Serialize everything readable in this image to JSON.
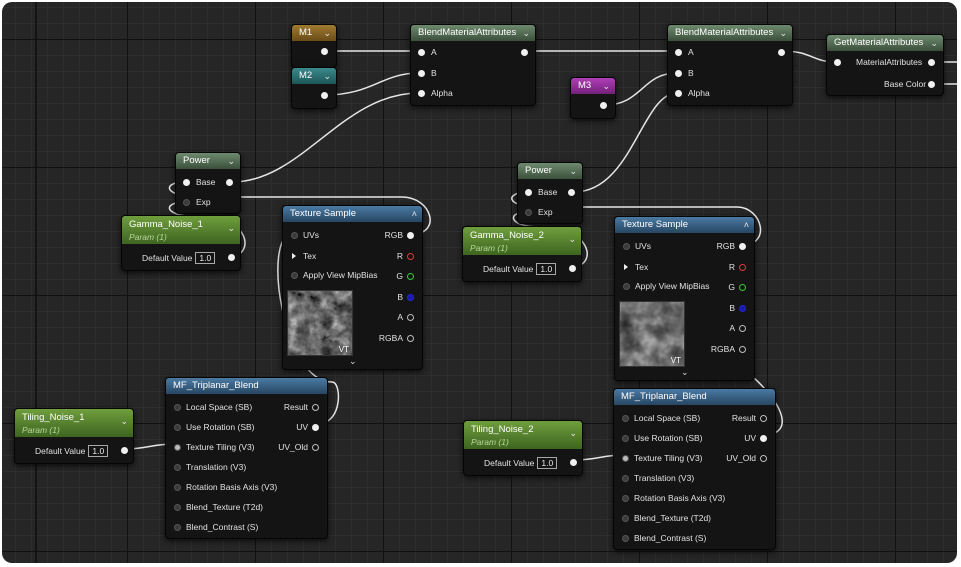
{
  "nodes": {
    "m1": {
      "label": "M1"
    },
    "m2": {
      "label": "M2"
    },
    "m3": {
      "label": "M3"
    },
    "blend1": {
      "title": "BlendMaterialAttributes",
      "pins": [
        "A",
        "B",
        "Alpha"
      ]
    },
    "blend2": {
      "title": "BlendMaterialAttributes",
      "pins": [
        "A",
        "B",
        "Alpha"
      ]
    },
    "getmat": {
      "title": "GetMaterialAttributes",
      "pins": [
        "MaterialAttributes",
        "Base Color"
      ]
    },
    "power1": {
      "title": "Power",
      "pins": [
        "Base",
        "Exp"
      ]
    },
    "power2": {
      "title": "Power",
      "pins": [
        "Base",
        "Exp"
      ]
    },
    "gamma1": {
      "title": "Gamma_Noise_1",
      "sub": "Param (1)",
      "value_label": "Default Value",
      "value": "1.0"
    },
    "gamma2": {
      "title": "Gamma_Noise_2",
      "sub": "Param (1)",
      "value_label": "Default Value",
      "value": "1.0"
    },
    "tiling1": {
      "title": "Tiling_Noise_1",
      "sub": "Param (1)",
      "value_label": "Default Value",
      "value": "1.0"
    },
    "tiling2": {
      "title": "Tiling_Noise_2",
      "sub": "Param (1)",
      "value_label": "Default Value",
      "value": "1.0"
    },
    "tex1": {
      "title": "Texture Sample",
      "inputs": [
        "UVs",
        "Tex",
        "Apply View MipBias"
      ],
      "outputs": [
        "RGB",
        "R",
        "G",
        "B",
        "A",
        "RGBA"
      ],
      "badge": "VT"
    },
    "tex2": {
      "title": "Texture Sample",
      "inputs": [
        "UVs",
        "Tex",
        "Apply View MipBias"
      ],
      "outputs": [
        "RGB",
        "R",
        "G",
        "B",
        "A",
        "RGBA"
      ],
      "badge": "VT"
    },
    "tri1": {
      "title": "MF_Triplanar_Blend",
      "inputs": [
        "Local Space (SB)",
        "Use Rotation (SB)",
        "Texture Tiling (V3)",
        "Translation (V3)",
        "Rotation Basis Axis (V3)",
        "Blend_Texture (T2d)",
        "Blend_Contrast (S)"
      ],
      "outputs": [
        "Result",
        "UV",
        "UV_Old"
      ]
    },
    "tri2": {
      "title": "MF_Triplanar_Blend",
      "inputs": [
        "Local Space (SB)",
        "Use Rotation (SB)",
        "Texture Tiling (V3)",
        "Translation (V3)",
        "Rotation Basis Axis (V3)",
        "Blend_Texture (T2d)",
        "Blend_Contrast (S)"
      ],
      "outputs": [
        "Result",
        "UV",
        "UV_Old"
      ]
    }
  },
  "icons": {
    "chevron": "chevron-down-icon",
    "collapse": "collapse-arrow-icon"
  }
}
